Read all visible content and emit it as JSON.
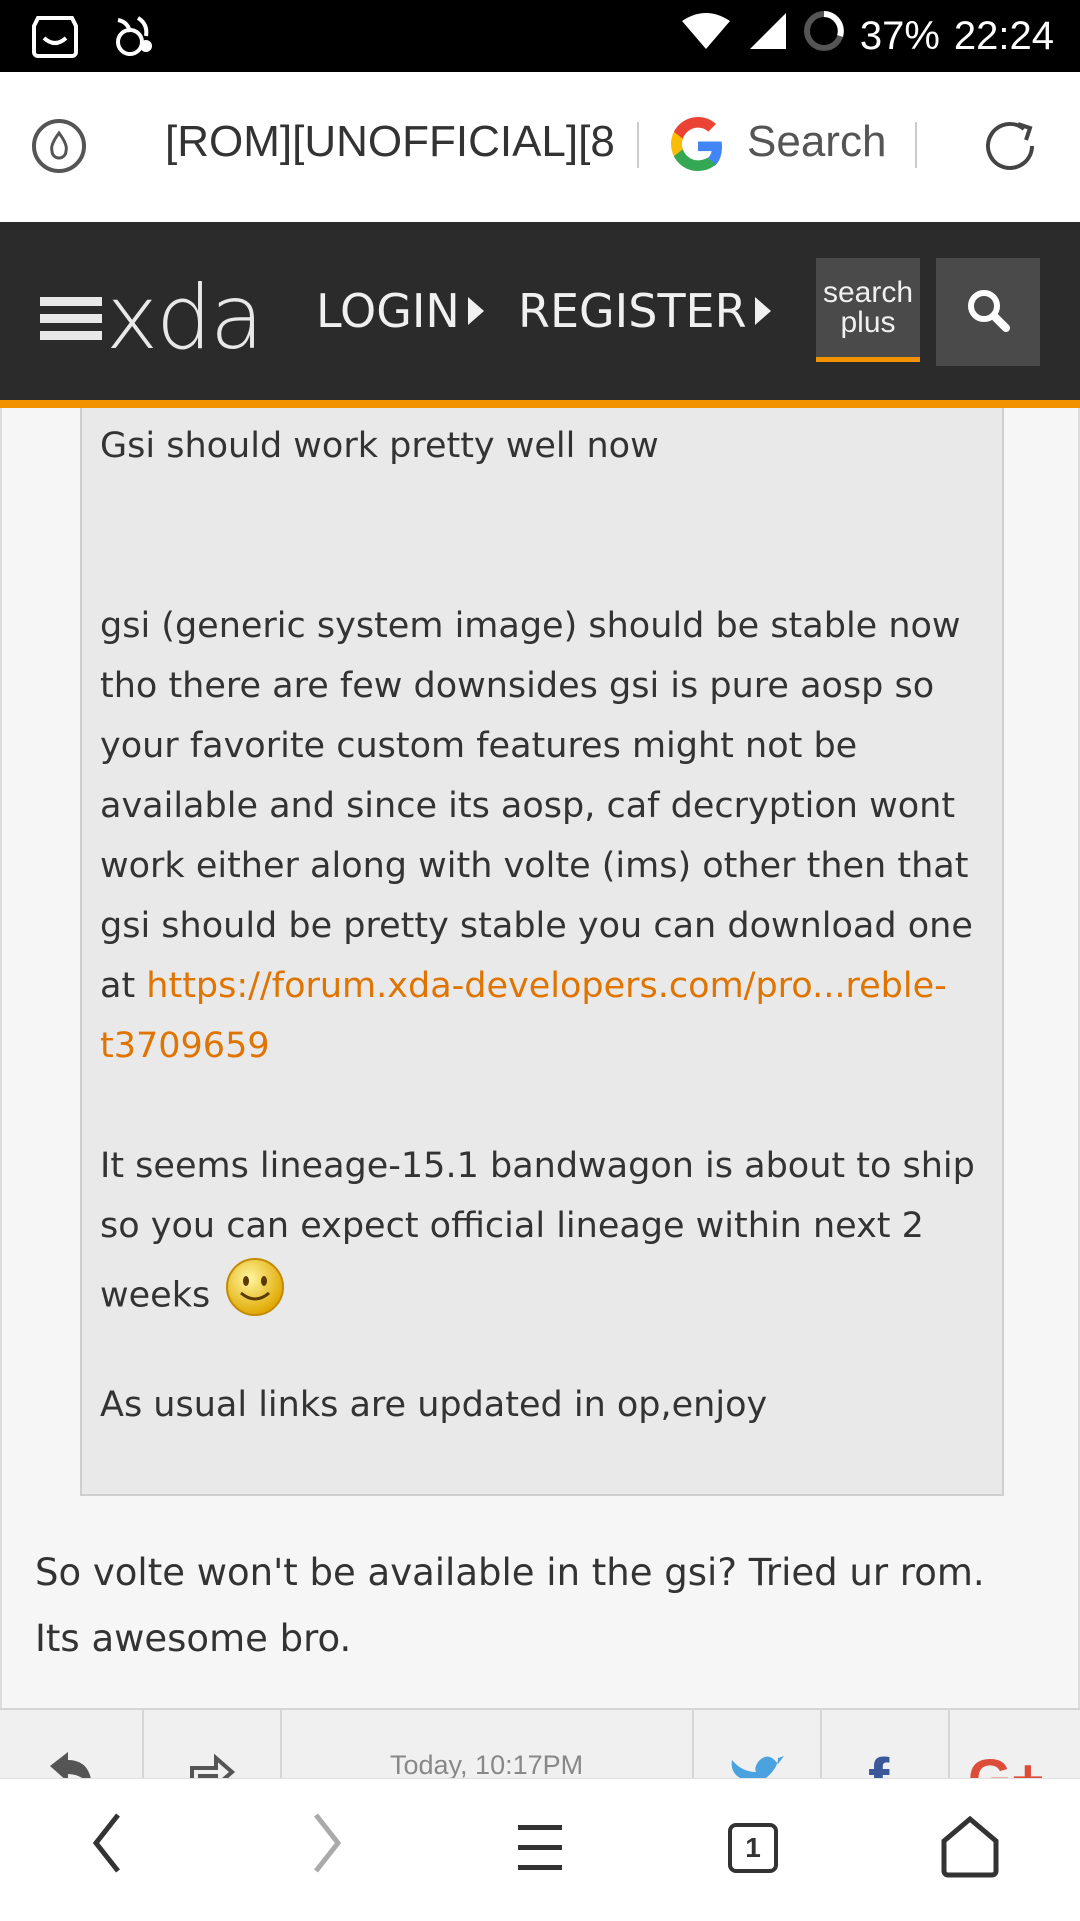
{
  "status_bar": {
    "battery": "37%",
    "time": "22:24"
  },
  "address_bar": {
    "url": "[ROM][UNOFFICIAL][8.",
    "search_label": "Search"
  },
  "xda_header": {
    "logo": "xda",
    "login": "LOGIN",
    "register": "REGISTER",
    "search_plus_line1": "search",
    "search_plus_line2": "plus"
  },
  "post": {
    "quote": {
      "line_top": "Gsi should work pretty well now",
      "para1_text": "gsi (generic system image) should be stable now tho there are few downsides gsi is pure aosp so your favorite custom features might not be available and since its aosp, caf decryption wont work either along with volte (ims) other then that gsi should be pretty stable you can download one at ",
      "para1_link": "https://forum.xda-developers.com/pro...reble-t3709659",
      "para2": "It seems lineage-15.1 bandwagon is about to ship so you can expect official lineage within next 2 weeks",
      "para3": "As usual links are updated in op,enjoy"
    },
    "reply": "So volte won't be available in the gsi? Tried ur rom. Its awesome bro.",
    "timestamp": "Today, 10:17PM"
  },
  "bottom_nav": {
    "tab_count": "1"
  }
}
